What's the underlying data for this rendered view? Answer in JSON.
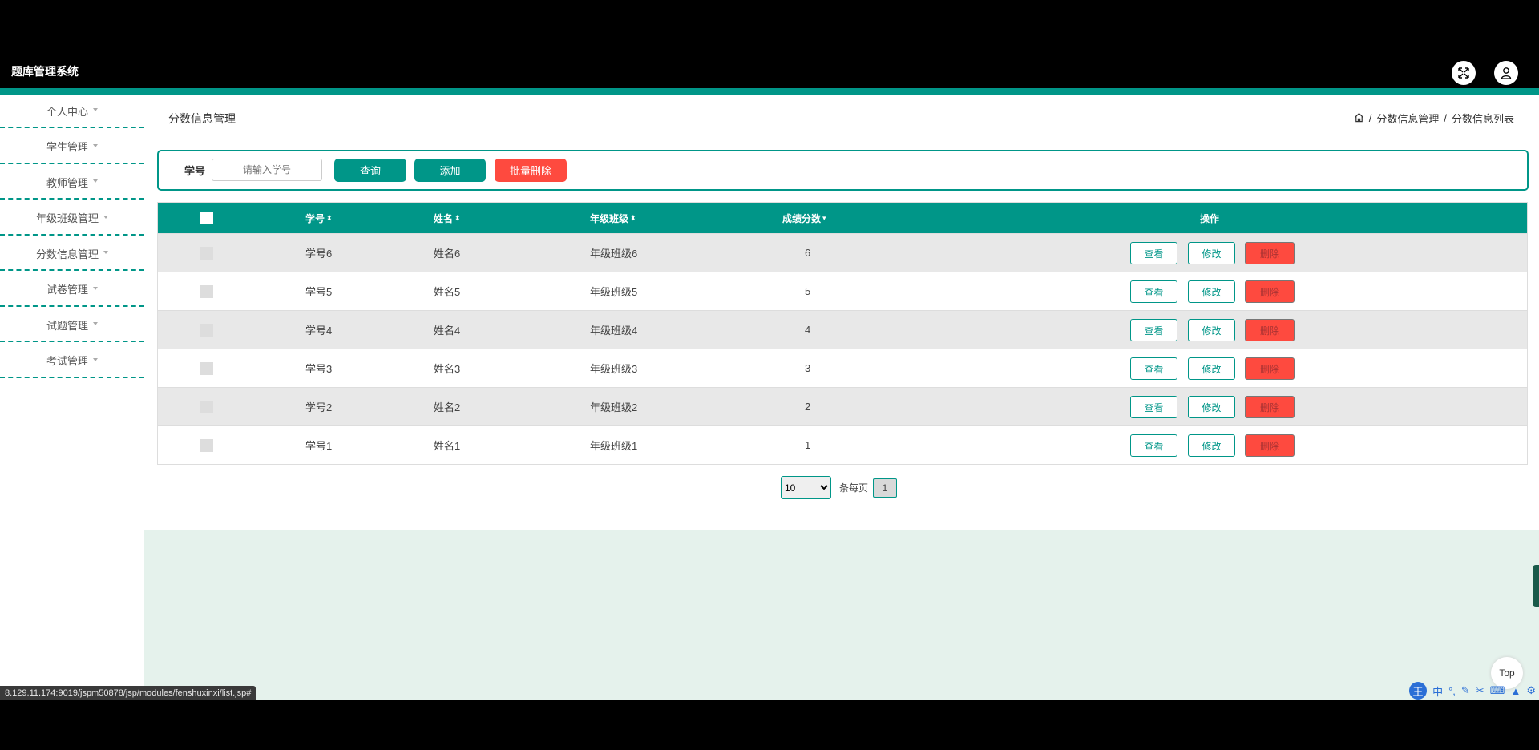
{
  "app": {
    "title": "题库管理系统"
  },
  "sidebar": {
    "items": [
      {
        "label": "个人中心"
      },
      {
        "label": "学生管理"
      },
      {
        "label": "教师管理"
      },
      {
        "label": "年级班级管理"
      },
      {
        "label": "分数信息管理"
      },
      {
        "label": "试卷管理"
      },
      {
        "label": "试题管理"
      },
      {
        "label": "考试管理"
      }
    ]
  },
  "page": {
    "title": "分数信息管理",
    "breadcrumb": [
      "分数信息管理",
      "分数信息列表"
    ]
  },
  "search": {
    "label": "学号",
    "placeholder": "请输入学号",
    "query_label": "查询",
    "add_label": "添加",
    "batch_delete_label": "批量删除"
  },
  "table": {
    "headers": {
      "xuehao": "学号",
      "xingming": "姓名",
      "banji": "年级班级",
      "fenshu": "成绩分数",
      "actions": "操作"
    },
    "rows": [
      {
        "xuehao": "学号6",
        "xingming": "姓名6",
        "banji": "年级班级6",
        "fenshu": "6"
      },
      {
        "xuehao": "学号5",
        "xingming": "姓名5",
        "banji": "年级班级5",
        "fenshu": "5"
      },
      {
        "xuehao": "学号4",
        "xingming": "姓名4",
        "banji": "年级班级4",
        "fenshu": "4"
      },
      {
        "xuehao": "学号3",
        "xingming": "姓名3",
        "banji": "年级班级3",
        "fenshu": "3"
      },
      {
        "xuehao": "学号2",
        "xingming": "姓名2",
        "banji": "年级班级2",
        "fenshu": "2"
      },
      {
        "xuehao": "学号1",
        "xingming": "姓名1",
        "banji": "年级班级1",
        "fenshu": "1"
      }
    ],
    "actions": {
      "view": "查看",
      "edit": "修改",
      "delete": "删除"
    }
  },
  "pager": {
    "page_size": "10",
    "per_page_label": "条每页",
    "current_page": "1"
  },
  "misc": {
    "top_label": "Top",
    "status_url": "8.129.11.174:9019/jspm50878/jsp/modules/fenshuxinxi/list.jsp#",
    "ime_badge": "王",
    "ime_mode": "中"
  },
  "colors": {
    "primary": "#009688",
    "danger": "#fe4a3f",
    "lower_bg": "#e5f2ec"
  }
}
